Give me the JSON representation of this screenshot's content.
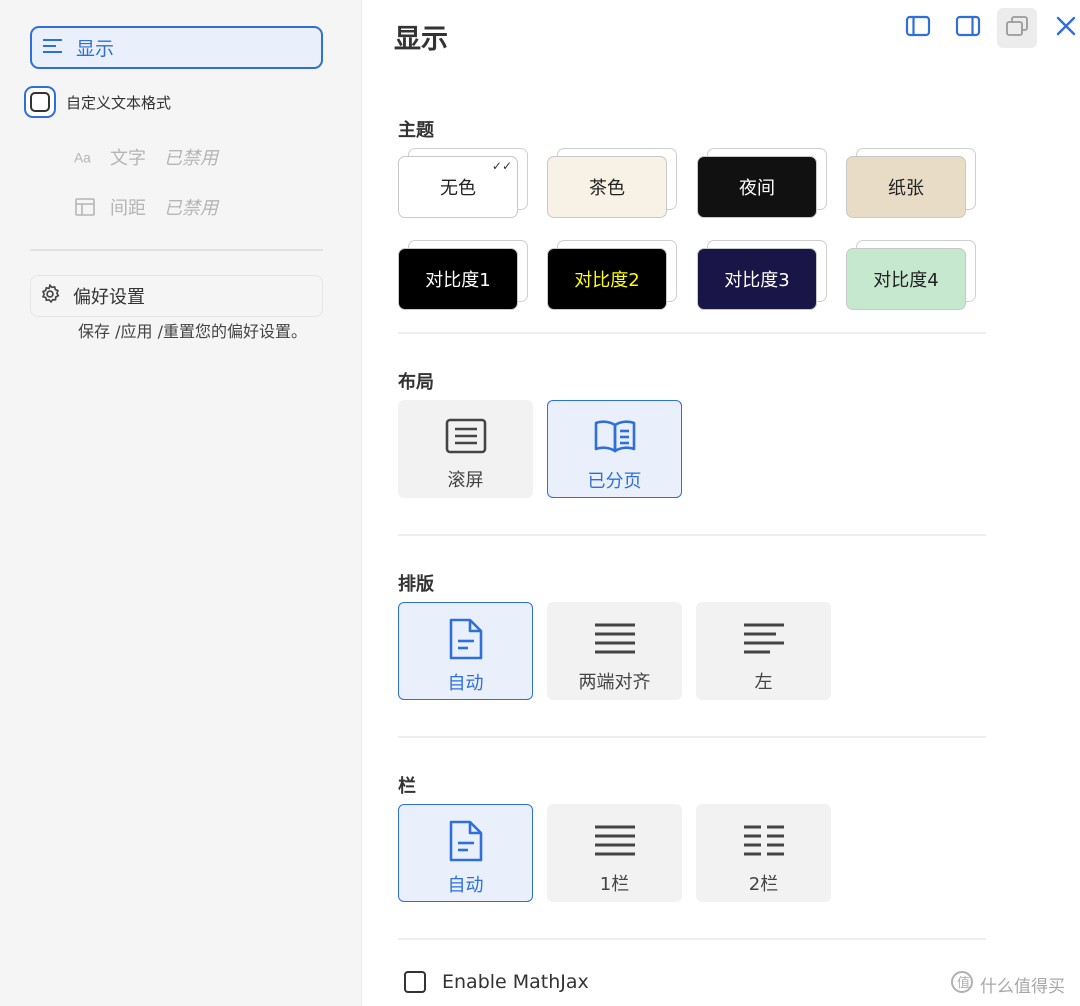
{
  "sidebar": {
    "display_label": "显示",
    "custom_format_label": "自定义文本格式",
    "text": {
      "label": "文字",
      "status": "已禁用"
    },
    "spacing": {
      "label": "间距",
      "status": "已禁用"
    },
    "preferences": {
      "label": "偏好设置",
      "description": "保存 /应用 /重置您的偏好设置。"
    }
  },
  "header": {
    "title": "显示"
  },
  "theme": {
    "label": "主题",
    "options": [
      {
        "label": "无色",
        "bg": "#ffffff",
        "fg": "#222222",
        "selected": true,
        "check": "✓✓"
      },
      {
        "label": "茶色",
        "bg": "#f7f1e6",
        "fg": "#222222"
      },
      {
        "label": "夜间",
        "bg": "#111111",
        "fg": "#ffffff"
      },
      {
        "label": "纸张",
        "bg": "#e8dcc6",
        "fg": "#222222"
      },
      {
        "label": "对比度1",
        "bg": "#000000",
        "fg": "#ffffff"
      },
      {
        "label": "对比度2",
        "bg": "#000000",
        "fg": "#ffff00"
      },
      {
        "label": "对比度3",
        "bg": "#191546",
        "fg": "#ffffff"
      },
      {
        "label": "对比度4",
        "bg": "#c6e8cf",
        "fg": "#222222"
      }
    ]
  },
  "layout": {
    "label": "布局",
    "options": [
      {
        "label": "滚屏",
        "icon": "scroll-icon",
        "selected": false
      },
      {
        "label": "已分页",
        "icon": "book-icon",
        "selected": true
      }
    ]
  },
  "typesetting": {
    "label": "排版",
    "options": [
      {
        "label": "自动",
        "icon": "document-icon",
        "selected": true
      },
      {
        "label": "两端对齐",
        "icon": "justify-icon",
        "selected": false
      },
      {
        "label": "左",
        "icon": "align-left-icon",
        "selected": false
      }
    ]
  },
  "columns": {
    "label": "栏",
    "options": [
      {
        "label": "自动",
        "icon": "document-icon",
        "selected": true
      },
      {
        "label": "1栏",
        "icon": "one-column-icon",
        "selected": false
      },
      {
        "label": "2栏",
        "icon": "two-column-icon",
        "selected": false
      }
    ]
  },
  "mathjax": {
    "label": "Enable MathJax",
    "checked": false
  },
  "watermark": {
    "text": "什么值得买"
  },
  "colors": {
    "accent": "#2f6fdb",
    "sidebar_bg": "#f5f5f5",
    "option_bg": "#f2f2f2",
    "selected_bg": "#eaf0fb"
  }
}
